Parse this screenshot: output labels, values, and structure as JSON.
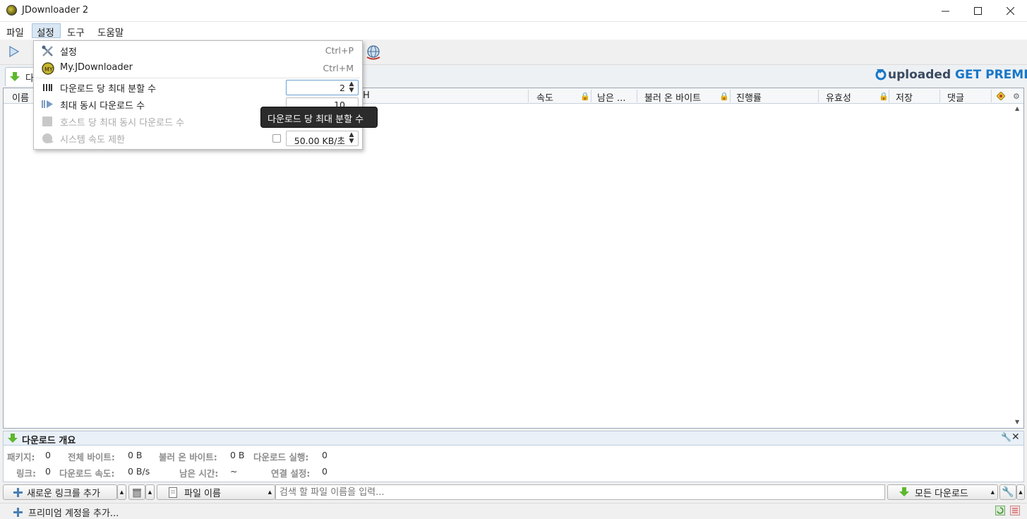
{
  "window": {
    "title": "JDownloader 2"
  },
  "menubar": {
    "file": "파일",
    "settings": "설정",
    "tools": "도구",
    "help": "도움말"
  },
  "tab": {
    "label": "다"
  },
  "banner": {
    "brand": "uploaded",
    "cta": "GET PREMIUM!"
  },
  "table": {
    "columns": [
      "이름",
      "속도",
      "남은 ...",
      "불러 온 바이트",
      "진행률",
      "유효성",
      "저장",
      "댓글"
    ],
    "partial_header": "H"
  },
  "overview": {
    "title": "다운로드 개요",
    "packages_label": "패키지:",
    "packages_value": "0",
    "total_bytes_label": "전체 바이트:",
    "total_bytes_value": "0 B",
    "loaded_bytes_label": "불러 온 바이트:",
    "loaded_bytes_value": "0 B",
    "running_label": "다운로드 실행:",
    "running_value": "0",
    "links_label": "링크:",
    "links_value": "0",
    "speed_label": "다운로드 속도:",
    "speed_value": "0 B/s",
    "eta_label": "남은 시간:",
    "eta_value": "~",
    "connections_label": "연결 설정:",
    "connections_value": "0"
  },
  "bottombar": {
    "add_links": "새로운 링크를 추가",
    "filename_filter": "파일 이름",
    "search_placeholder": "검색 할 파일 이름을 입력...",
    "all_downloads": "모든 다운로드"
  },
  "statusbar": {
    "add_premium": "프리미엄 계정을 추가..."
  },
  "dropdown": {
    "items": [
      {
        "label": "설정",
        "shortcut": "Ctrl+P"
      },
      {
        "label": "My.JDownloader",
        "shortcut": "Ctrl+M"
      },
      {
        "label": "다운로드 당 최대 분할 수",
        "value": "2"
      },
      {
        "label": "최대 동시 다운로드 수",
        "value": "10"
      },
      {
        "label": "호스트 당 최대 동시 다운로드 수"
      },
      {
        "label": "시스템 속도 제한",
        "value": "50.00 KB/초"
      }
    ]
  },
  "tooltip": {
    "text": "다운로드 당 최대 분할 수"
  }
}
